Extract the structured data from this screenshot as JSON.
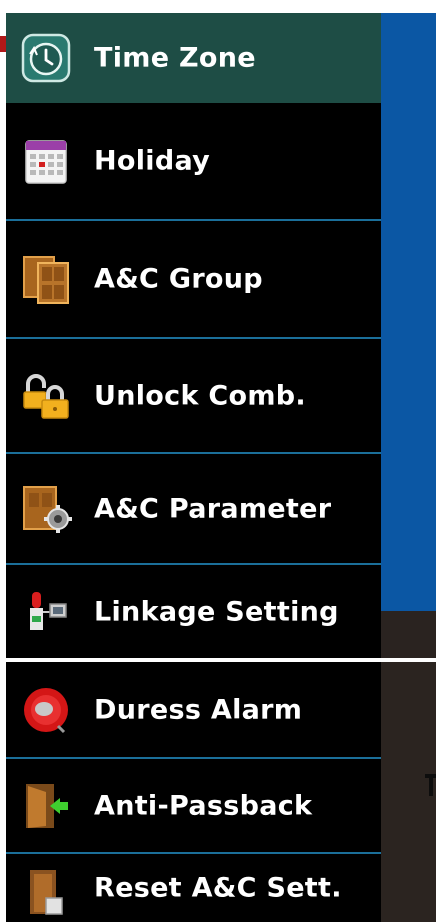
{
  "menu": {
    "items": [
      {
        "label": "Time Zone",
        "icon": "clock-icon"
      },
      {
        "label": "Holiday",
        "icon": "calendar-icon"
      },
      {
        "label": "A&C Group",
        "icon": "door-group-icon"
      },
      {
        "label": "Unlock Comb.",
        "icon": "padlock-icon"
      },
      {
        "label": "A&C Parameter",
        "icon": "door-gear-icon"
      },
      {
        "label": "Linkage Setting",
        "icon": "linkage-icon"
      },
      {
        "label": "Duress Alarm",
        "icon": "alarm-icon"
      },
      {
        "label": "Anti-Passback",
        "icon": "exit-door-icon"
      },
      {
        "label": "Reset A&C Sett.",
        "icon": "reset-door-icon"
      }
    ],
    "selected_index": 0
  },
  "colors": {
    "menu_background": "#000000",
    "selected_background": "#1e4d45",
    "divider": "#1b6f9a",
    "side_panel": "#0b57a4",
    "text": "#ffffff"
  }
}
